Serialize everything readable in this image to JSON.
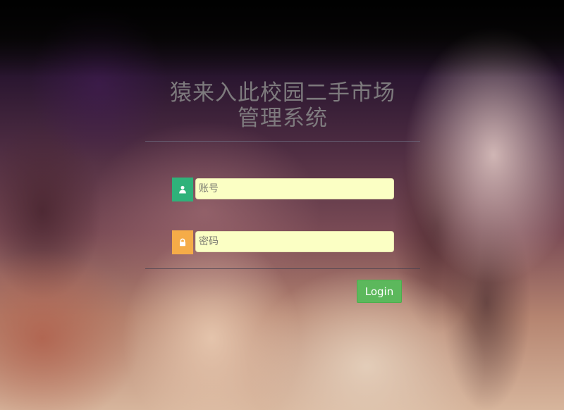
{
  "header": {
    "title_line1": "猿来入此校园二手市场",
    "title_line2": "管理系统"
  },
  "form": {
    "username": {
      "icon": "user-icon",
      "placeholder": "账号",
      "value": ""
    },
    "password": {
      "icon": "lock-icon",
      "placeholder": "密码",
      "value": ""
    },
    "login_label": "Login"
  },
  "colors": {
    "user_icon_bg": "#2fb27a",
    "lock_icon_bg": "#f5ac48",
    "input_bg": "#fbffc4",
    "login_button": "#5cb85c"
  }
}
